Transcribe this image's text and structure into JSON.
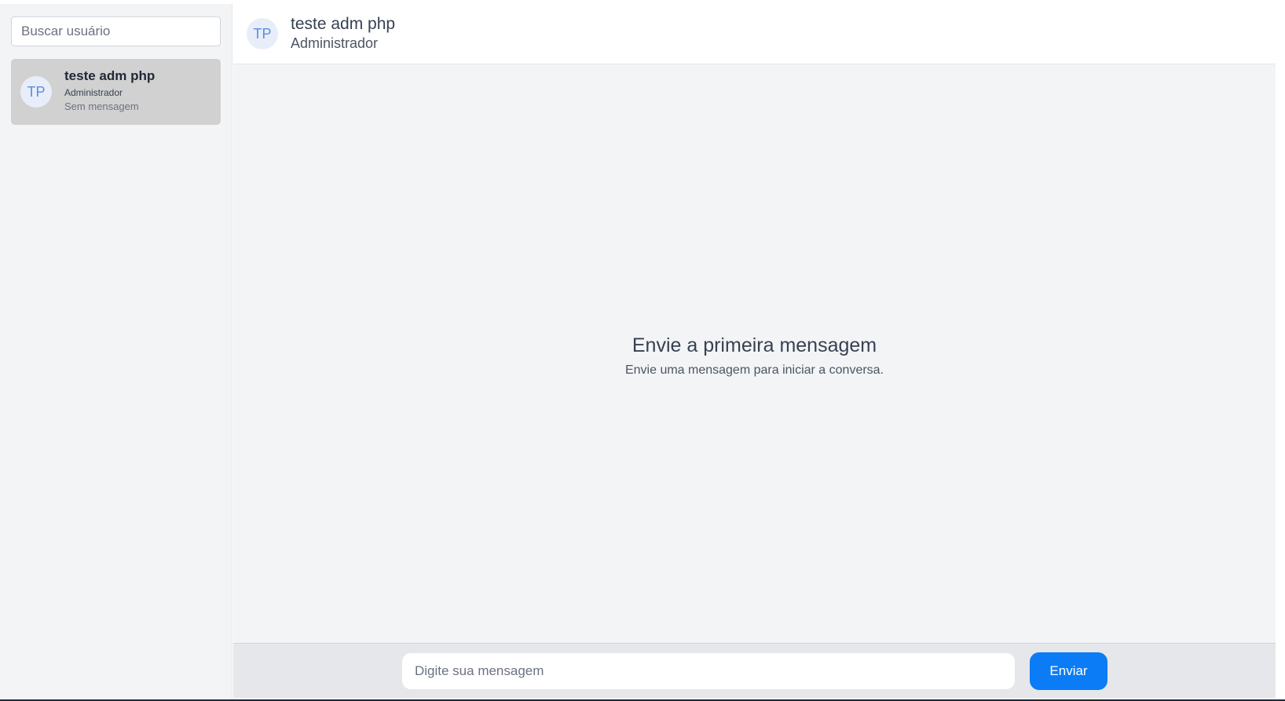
{
  "sidebar": {
    "search_placeholder": "Buscar usuário",
    "contacts": [
      {
        "initials": "TP",
        "name": "teste adm php",
        "role": "Administrador",
        "last_message": "Sem mensagem"
      }
    ]
  },
  "chat": {
    "header": {
      "initials": "TP",
      "name": "teste adm php",
      "role": "Administrador"
    },
    "empty_state": {
      "title": "Envie a primeira mensagem",
      "subtitle": "Envie uma mensagem para iniciar a conversa."
    },
    "composer": {
      "placeholder": "Digite sua mensagem",
      "send_label": "Enviar"
    }
  },
  "colors": {
    "accent": "#0b7cf5",
    "avatar_bg": "#e8eef9",
    "avatar_text": "#5b8de0",
    "selected_contact_bg": "#d1d1d1"
  }
}
